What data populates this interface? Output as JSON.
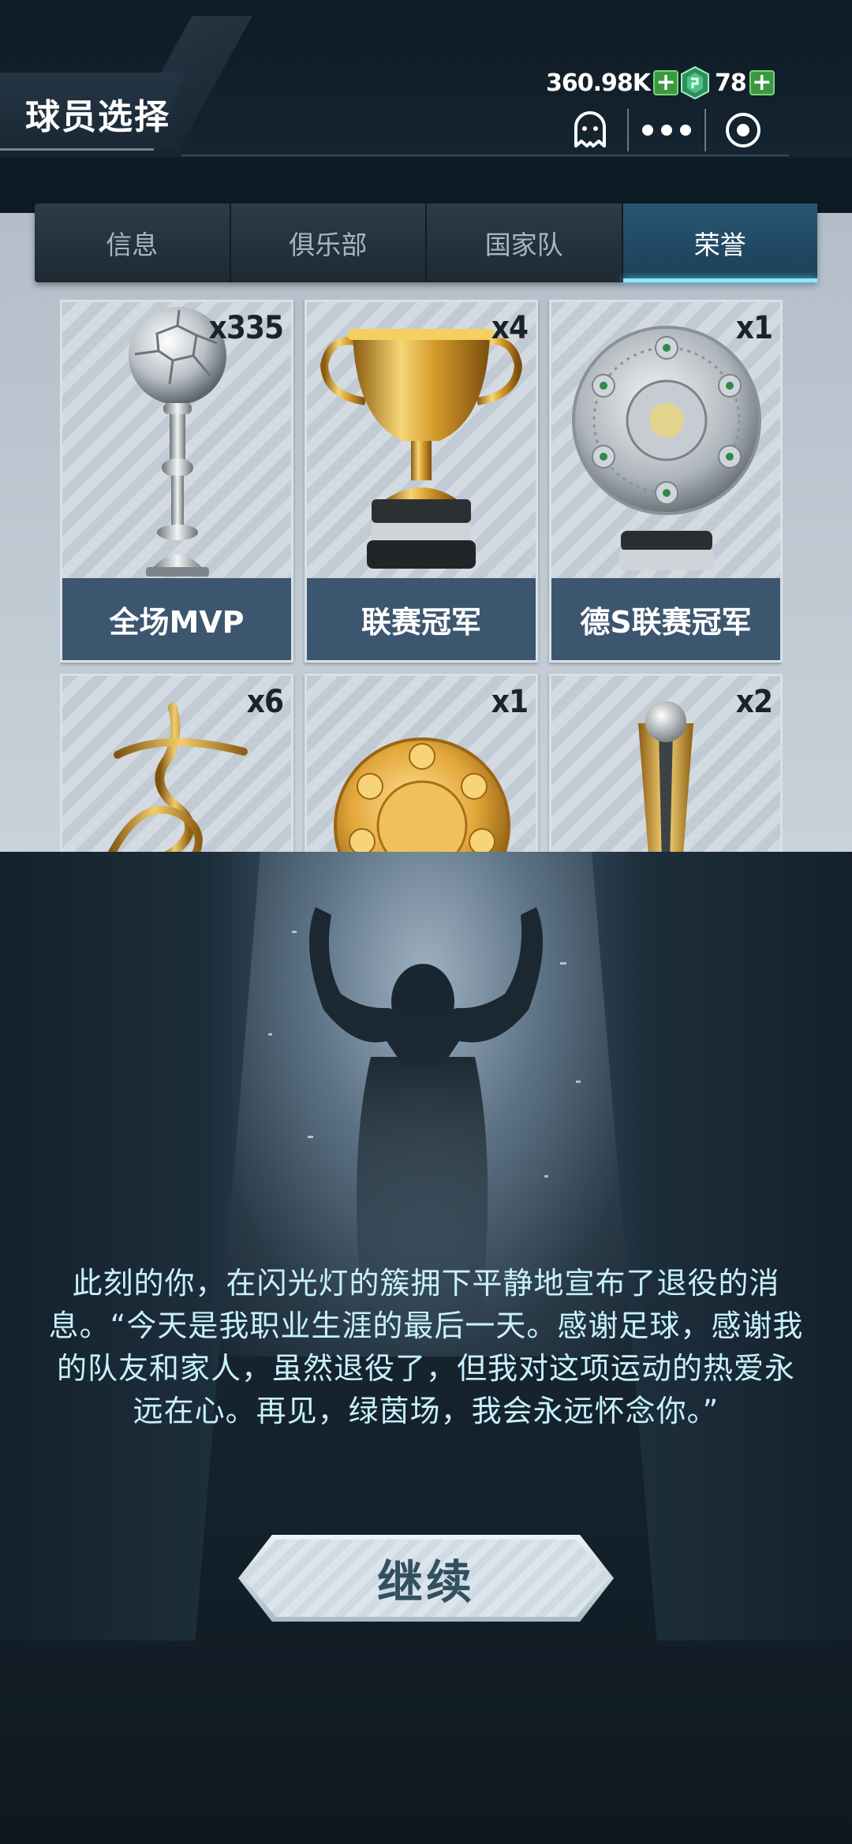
{
  "header": {
    "title": "球员选择",
    "coins": "360.98K",
    "gems": "78",
    "icons": [
      "plus-icon",
      "gem-icon",
      "ghost-icon",
      "more-icon",
      "record-icon"
    ]
  },
  "tabs": [
    {
      "label": "信息",
      "active": false
    },
    {
      "label": "俱乐部",
      "active": false
    },
    {
      "label": "国家队",
      "active": false
    },
    {
      "label": "荣誉",
      "active": true
    }
  ],
  "honors": [
    {
      "label": "全场MVP",
      "count": "x335",
      "icon": "silver-ball-trophy-icon"
    },
    {
      "label": "联赛冠军",
      "count": "x4",
      "icon": "gold-cup-trophy-icon"
    },
    {
      "label": "德S联赛冠军",
      "count": "x1",
      "icon": "silver-plate-trophy-icon"
    },
    {
      "label": "",
      "count": "x6",
      "icon": "gold-swirl-trophy-icon"
    },
    {
      "label": "",
      "count": "x1",
      "icon": "gold-plate-trophy-icon"
    },
    {
      "label": "",
      "count": "x2",
      "icon": "gold-boot-trophy-icon"
    }
  ],
  "story": {
    "text": "此刻的你，在闪光灯的簇拥下平静地宣布了退役的消息。“今天是我职业生涯的最后一天。感谢足球，感谢我的队友和家人，虽然退役了，但我对这项运动的热爱永远在心。再见，绿茵场，我会永远怀念你。”",
    "continue_label": "继续"
  },
  "colors": {
    "accent": "#8fe6ff",
    "card_label_bg": "#3d5670",
    "story_text": "#c7f1ff",
    "plus_green": "#3a9a3e"
  }
}
